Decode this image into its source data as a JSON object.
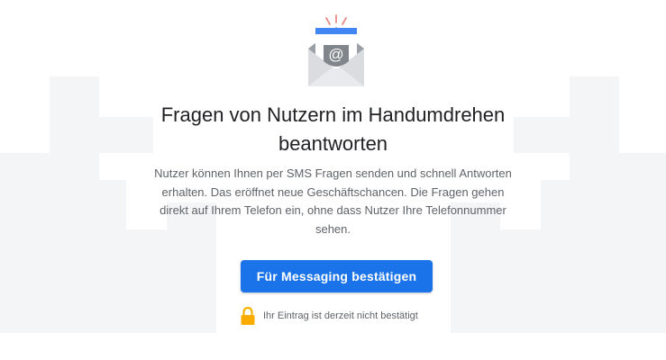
{
  "empty_state": {
    "headline": "Fragen von Nutzern im Handumdrehen beantworten",
    "description": "Nutzer können Ihnen per SMS Fragen senden und schnell Antworten erhalten. Das eröffnet neue Geschäftschancen. Die Fragen gehen direkt auf Ihrem Telefon ein, ohne dass Nutzer Ihre Telefonnummer sehen.",
    "illustration_icon": "envelope-at-icon",
    "action_button": {
      "label": "Für Messaging bestätigen"
    },
    "status": {
      "icon": "lock-icon",
      "text": "Ihr Eintrag ist derzeit nicht bestätigt"
    }
  },
  "colors": {
    "primary": "#1a73e8",
    "headline": "#202124",
    "body_text": "#5f6368",
    "lock": "#f9ab00",
    "background_blocks": "#f4f5f6"
  }
}
